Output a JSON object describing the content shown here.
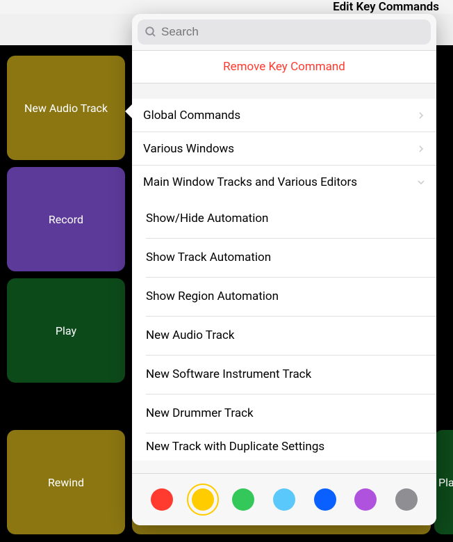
{
  "header": {
    "title": "Edit Key Commands"
  },
  "buttons": {
    "newAudioTrack": "New Audio Track",
    "record": "Record",
    "play": "Play",
    "rewind": "Rewind",
    "playPeek": "Play"
  },
  "popover": {
    "searchPlaceholder": "Search",
    "removeLabel": "Remove Key Command",
    "categories": [
      {
        "label": "Global Commands",
        "expanded": false
      },
      {
        "label": "Various Windows",
        "expanded": false
      },
      {
        "label": "Main Window Tracks and Various Editors",
        "expanded": true
      }
    ],
    "subItems": [
      "Show/Hide Automation",
      "Show Track Automation",
      "Show Region Automation",
      "New Audio Track",
      "New Software Instrument Track",
      "New Drummer Track",
      "New Track with Duplicate Settings"
    ],
    "colors": [
      {
        "name": "red",
        "hex": "#ff3b30",
        "selected": false
      },
      {
        "name": "yellow",
        "hex": "#ffcc00",
        "selected": true
      },
      {
        "name": "green",
        "hex": "#34c759",
        "selected": false
      },
      {
        "name": "lightblue",
        "hex": "#5ac8fa",
        "selected": false
      },
      {
        "name": "blue",
        "hex": "#0a60ff",
        "selected": false
      },
      {
        "name": "purple",
        "hex": "#af52de",
        "selected": false
      },
      {
        "name": "grey",
        "hex": "#8e8e93",
        "selected": false
      }
    ]
  }
}
